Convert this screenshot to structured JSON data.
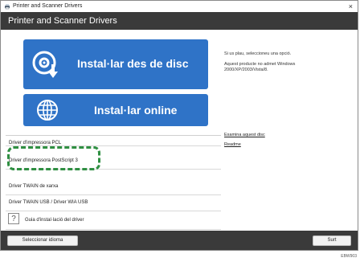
{
  "window": {
    "title": "Printer and Scanner Drivers",
    "close_glyph": "×",
    "icon": "printer-icon"
  },
  "header": {
    "title": "Printer and Scanner Drivers"
  },
  "buttons": {
    "install_disc": "Instal·lar des de disc",
    "install_online": "Instal·lar online"
  },
  "driver_list": {
    "items": [
      {
        "label": "Driver d'impressora PCL"
      },
      {
        "label": "Driver d'impressora PostScript 3"
      },
      {
        "label": "Driver TWAIN de xarxa"
      },
      {
        "label": "Driver TWAIN USB / Driver WIA USB"
      }
    ],
    "guide_label": "Guia d'instal·lació del driver",
    "guide_icon_glyph": "?"
  },
  "info": {
    "prompt": "Si us plau, seleccioneu una opció.",
    "warning": "Aquest producte no admet Windows 2000/XP/2003/Vista/8.",
    "links": [
      "Examina aquest disc",
      "Readme"
    ]
  },
  "footer": {
    "language_button": "Seleccionar idioma",
    "exit_button": "Surt"
  },
  "figure_code": "EBW903",
  "colors": {
    "header_bg": "#3a3a3a",
    "button_blue": "#2f73c7",
    "highlight_green": "#2f8f42"
  }
}
